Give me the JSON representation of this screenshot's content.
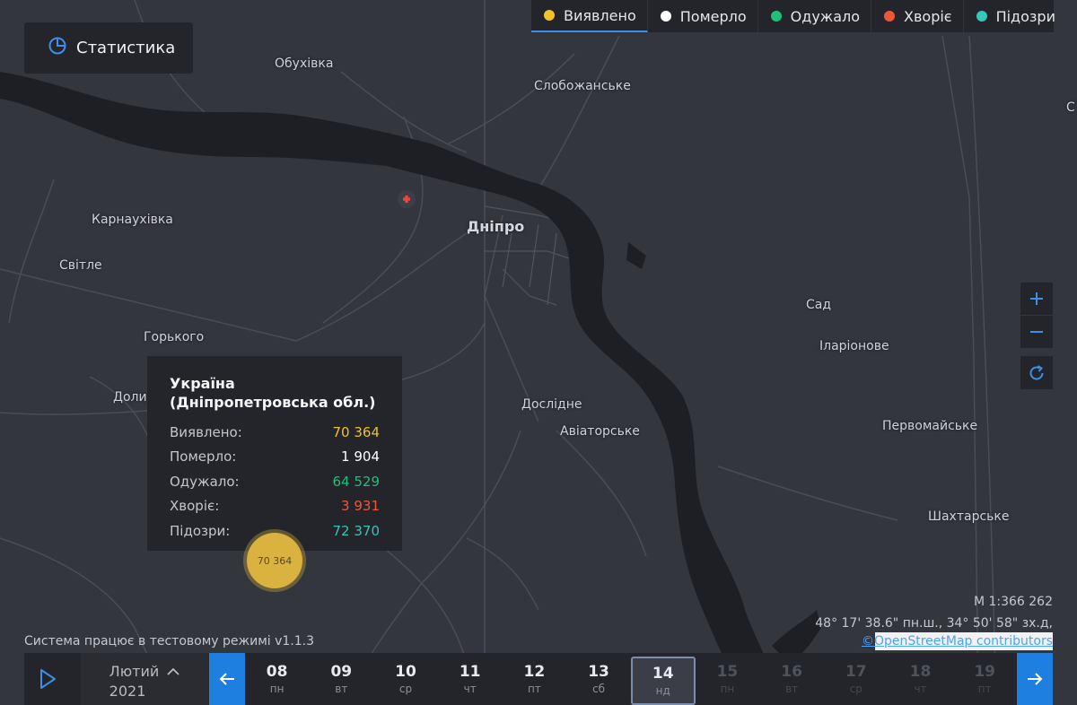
{
  "header": {
    "stats_label": "Статистика"
  },
  "legend": [
    {
      "label": "Виявлено",
      "color": "#f2c12e",
      "active": true
    },
    {
      "label": "Померло",
      "color": "#ffffff",
      "active": false
    },
    {
      "label": "Одужало",
      "color": "#1fbf7a",
      "active": false
    },
    {
      "label": "Хворіє",
      "color": "#f0553a",
      "active": false
    },
    {
      "label": "Підозри",
      "color": "#36c5b9",
      "active": false
    }
  ],
  "places": {
    "obukhivka": "Обухівка",
    "slobozhanske": "Слобожанське",
    "karnaukhivka": "Карнаухівка",
    "svitle": "Світле",
    "dnipro": "Дніпро",
    "gorkoho": "Горького",
    "doly": "Доли",
    "sad": "Сад",
    "ilarionove": "Іларіонове",
    "doslidne": "Дослідне",
    "aviatorske": "Авіаторське",
    "pervomaiske": "Первомайське",
    "shakhtarske": "Шахтарське",
    "edge_s": "С"
  },
  "tooltip": {
    "title": "Україна (Дніпропетровська обл.)",
    "rows": [
      {
        "label": "Виявлено:",
        "value": "70 364",
        "color": "#f2c12e"
      },
      {
        "label": "Померло:",
        "value": "1 904",
        "color": "#ffffff"
      },
      {
        "label": "Одужало:",
        "value": "64 529",
        "color": "#1fbf7a"
      },
      {
        "label": "Хворіє:",
        "value": "3 931",
        "color": "#f0553a"
      },
      {
        "label": "Підозри:",
        "value": "72 370",
        "color": "#36c5b9"
      }
    ]
  },
  "marker": {
    "label": "70 364"
  },
  "map_info": {
    "scale": "М 1:366 262",
    "coords": "48° 17' 38.6\" пн.ш., 34° 50' 58\" зх.д,",
    "attribution": "©OpenStreetMap contributors",
    "test_mode": "Система працює в тестовому режимі v1.1.3"
  },
  "timeline": {
    "month": "Лютий",
    "year": "2021",
    "days": [
      {
        "n": "08",
        "w": "пн",
        "state": "past"
      },
      {
        "n": "09",
        "w": "вт",
        "state": "past"
      },
      {
        "n": "10",
        "w": "ср",
        "state": "past"
      },
      {
        "n": "11",
        "w": "чт",
        "state": "past"
      },
      {
        "n": "12",
        "w": "пт",
        "state": "past"
      },
      {
        "n": "13",
        "w": "сб",
        "state": "past"
      },
      {
        "n": "14",
        "w": "нд",
        "state": "selected"
      },
      {
        "n": "15",
        "w": "пн",
        "state": "future"
      },
      {
        "n": "16",
        "w": "вт",
        "state": "future"
      },
      {
        "n": "17",
        "w": "ср",
        "state": "future"
      },
      {
        "n": "18",
        "w": "чт",
        "state": "future"
      },
      {
        "n": "19",
        "w": "пт",
        "state": "future"
      }
    ]
  }
}
